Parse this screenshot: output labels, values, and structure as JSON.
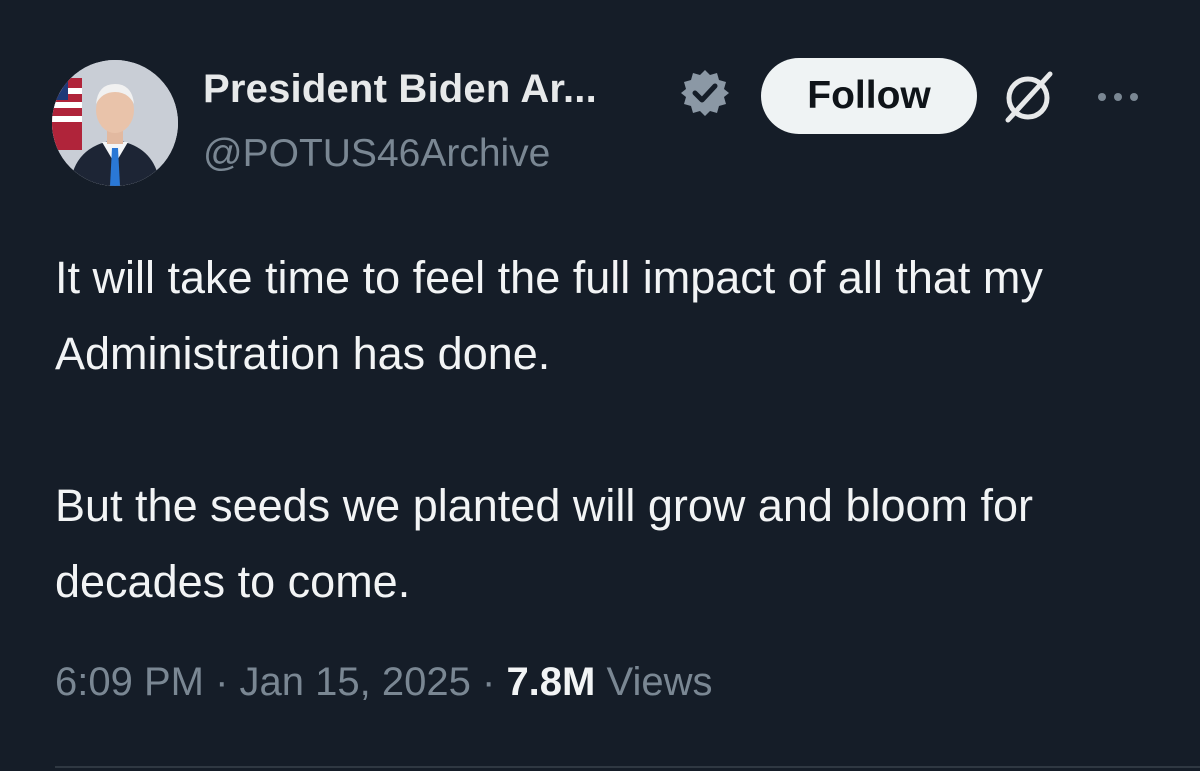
{
  "author": {
    "display_name": "President Biden Ar...",
    "handle": "@POTUS46Archive"
  },
  "actions": {
    "follow_label": "Follow",
    "icons": [
      "verified-badge-icon",
      "grok-icon",
      "more-icon"
    ]
  },
  "tweet": {
    "paragraphs": [
      "It will take time to feel the full impact of all that my Administration has done.",
      "But the seeds we planted will grow and bloom for decades to come."
    ]
  },
  "meta": {
    "time": "6:09 PM",
    "separator": "·",
    "date": "Jan 15, 2025",
    "views_count": "7.8M",
    "views_label": "Views"
  },
  "colors": {
    "background": "#151d28",
    "text": "#e7e9ea",
    "secondary": "#7a8793",
    "follow_bg": "#eff3f4"
  }
}
